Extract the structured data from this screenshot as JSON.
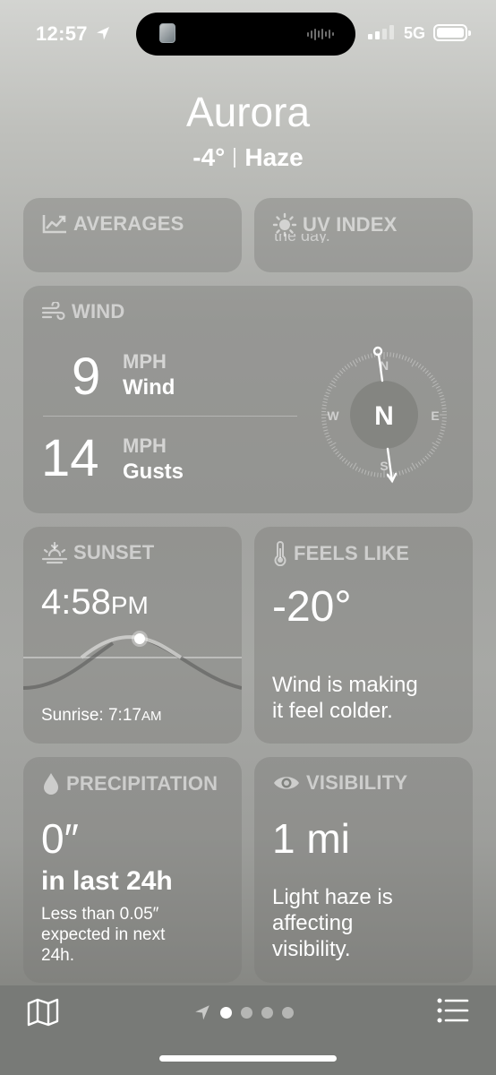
{
  "status_bar": {
    "time": "12:57",
    "network": "5G"
  },
  "header": {
    "city": "Aurora",
    "temperature": "-4°",
    "condition": "Haze"
  },
  "averages": {
    "title": "AVERAGES"
  },
  "uv_index": {
    "title": "UV INDEX",
    "partial_text": "the day."
  },
  "wind": {
    "title": "WIND",
    "speed_value": "9",
    "speed_unit": "MPH",
    "speed_label": "Wind",
    "gust_value": "14",
    "gust_unit": "MPH",
    "gust_label": "Gusts",
    "compass": {
      "north": "N",
      "east": "E",
      "south": "S",
      "west": "W",
      "center": "N"
    }
  },
  "sunset": {
    "title": "SUNSET",
    "time": "4:58",
    "ampm": "PM",
    "sunrise_label": "Sunrise: 7:17",
    "sunrise_ampm": "AM"
  },
  "feels_like": {
    "title": "FEELS LIKE",
    "value": "-20°",
    "description_line1": "Wind is making",
    "description_line2": "it feel colder."
  },
  "precipitation": {
    "title": "PRECIPITATION",
    "value": "0″",
    "period": "in last 24h",
    "line1": "Less than 0.05″",
    "line2": "expected in next",
    "line3": "24h."
  },
  "visibility": {
    "title": "VISIBILITY",
    "value": "1 mi",
    "line1": "Light haze is",
    "line2": "affecting",
    "line3": "visibility."
  },
  "tab_bar": {
    "pages": 4,
    "active_page": 1
  }
}
